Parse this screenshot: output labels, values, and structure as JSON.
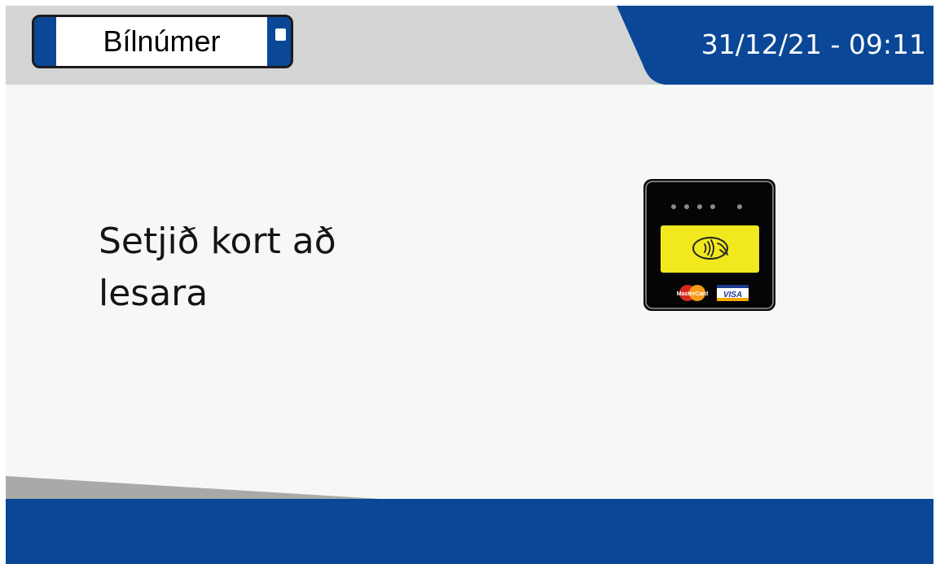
{
  "header": {
    "plate_label": "Bílnúmer",
    "datetime": "31/12/21 - 09:11"
  },
  "main": {
    "prompt_lines": [
      "Setjið kort að",
      "lesara"
    ],
    "card_reader": {
      "icon": "contactless-card-reader-icon",
      "brands": [
        "MasterCard",
        "VISA"
      ]
    }
  },
  "colors": {
    "brand_blue": "#0a4796",
    "header_gray": "#d4d4d4",
    "background": "#f5f8f5",
    "reader_yellow": "#f1e81e"
  }
}
